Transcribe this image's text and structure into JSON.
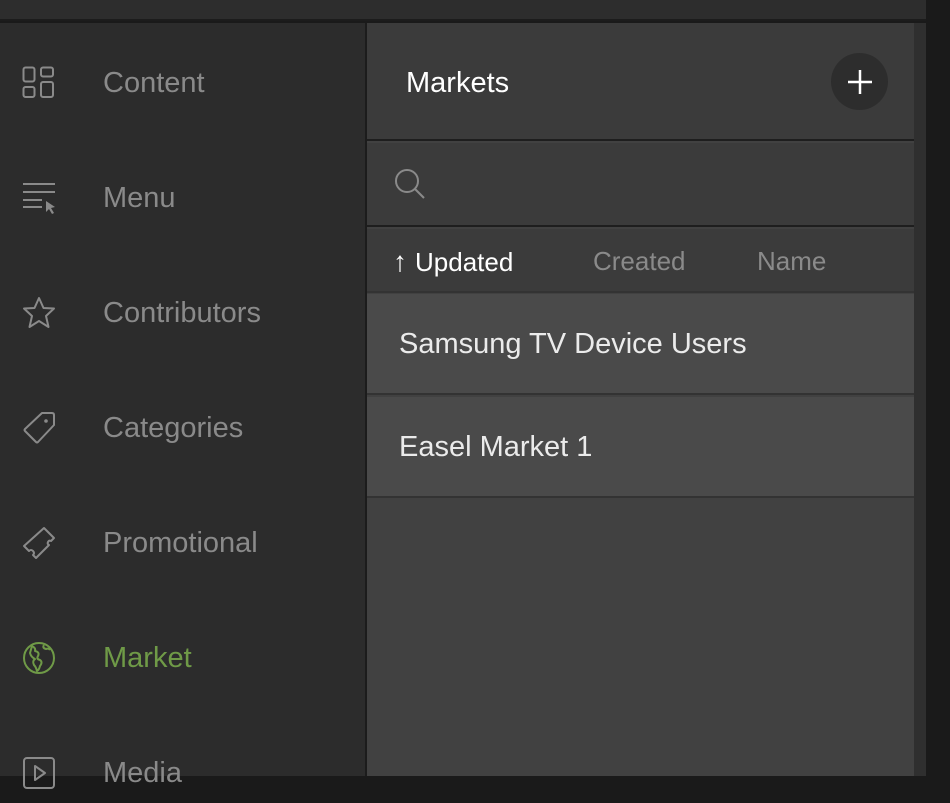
{
  "sidebar": {
    "items": [
      {
        "label": "Content",
        "icon": "grid-icon",
        "active": false
      },
      {
        "label": "Menu",
        "icon": "menu-cursor-icon",
        "active": false
      },
      {
        "label": "Contributors",
        "icon": "star-icon",
        "active": false
      },
      {
        "label": "Categories",
        "icon": "tag-icon",
        "active": false
      },
      {
        "label": "Promotional",
        "icon": "ticket-icon",
        "active": false
      },
      {
        "label": "Market",
        "icon": "globe-icon",
        "active": true
      },
      {
        "label": "Media",
        "icon": "play-icon",
        "active": false
      }
    ],
    "accent_color": "#6f9a47"
  },
  "panel": {
    "title": "Markets",
    "add_button_icon": "plus-icon",
    "search": {
      "value": "",
      "placeholder": ""
    },
    "sort": {
      "options": [
        "Updated",
        "Created",
        "Name"
      ],
      "active": "Updated",
      "direction_icon": "↑"
    },
    "rows": [
      {
        "name": "Samsung TV Device Users"
      },
      {
        "name": "Easel Market 1"
      }
    ]
  }
}
